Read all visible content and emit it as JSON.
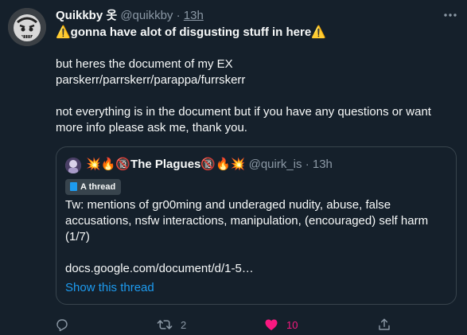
{
  "author": {
    "display_name": "Quikkby 옷",
    "handle": "@quikkby",
    "separator": "·",
    "time": "13h"
  },
  "tweet_lines": [
    "⚠️gonna have alot of disgusting stuff in here⚠️",
    "but heres the document of my EX",
    "parskerr/parrskerr/parappa/furrskerr",
    "not everything is in the document but if you have any questions or want",
    "more info please ask me, thank you."
  ],
  "quoted": {
    "display_name": "💥🔥🔞The Plagues🔞🔥💥",
    "handle": "@quirk_is",
    "separator": "·",
    "time": "13h",
    "badge_label": "A thread",
    "text_lines": [
      "Tw: mentions of gr00ming and underaged nudity, abuse, false",
      "accusations, nsfw interactions, manipulation, (encouraged) self harm",
      "(1/7)",
      "docs.google.com/document/d/1-5…"
    ],
    "show_thread": "Show this thread"
  },
  "actions": {
    "reply_count": "",
    "retweet_count": "2",
    "like_count": "10",
    "liked": true
  },
  "colors": {
    "background": "#15202b",
    "accent": "#1d9bf0",
    "like": "#f91880",
    "muted": "#8b98a5"
  },
  "icons": [
    "more-icon",
    "reply-icon",
    "retweet-icon",
    "heart-icon",
    "share-icon",
    "thread-icon"
  ]
}
